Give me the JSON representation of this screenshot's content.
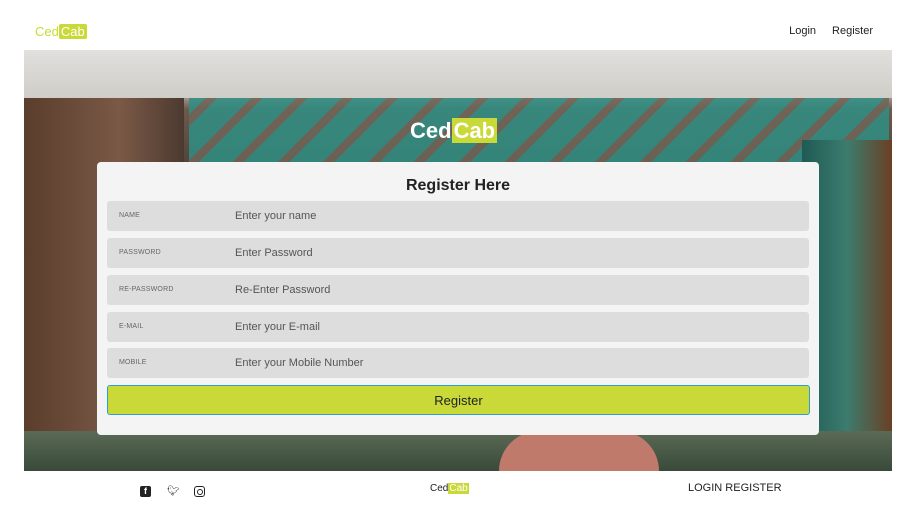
{
  "header": {
    "logo_part1": "Ced",
    "logo_part2": "Cab",
    "nav": [
      "Login",
      "Register"
    ]
  },
  "hero": {
    "brand_part1": "Ced",
    "brand_part2": "Cab"
  },
  "form": {
    "title": "Register Here",
    "fields": [
      {
        "label": "NAME",
        "placeholder": "Enter your name"
      },
      {
        "label": "PASSWORD",
        "placeholder": "Enter Password"
      },
      {
        "label": "RE-PASSWORD",
        "placeholder": "Re-Enter Password"
      },
      {
        "label": "E-MAIL",
        "placeholder": "Enter your E-mail"
      },
      {
        "label": "MOBILE",
        "placeholder": "Enter your Mobile Number"
      }
    ],
    "submit_label": "Register"
  },
  "footer": {
    "social_icons": [
      "facebook-icon",
      "twitter-icon",
      "instagram-icon"
    ],
    "logo_part1": "Ced",
    "logo_part2": "Cab",
    "links": [
      "LOGIN",
      "REGISTER"
    ]
  },
  "colors": {
    "accent": "#c9d937",
    "button_border": "#2a9fd6"
  }
}
